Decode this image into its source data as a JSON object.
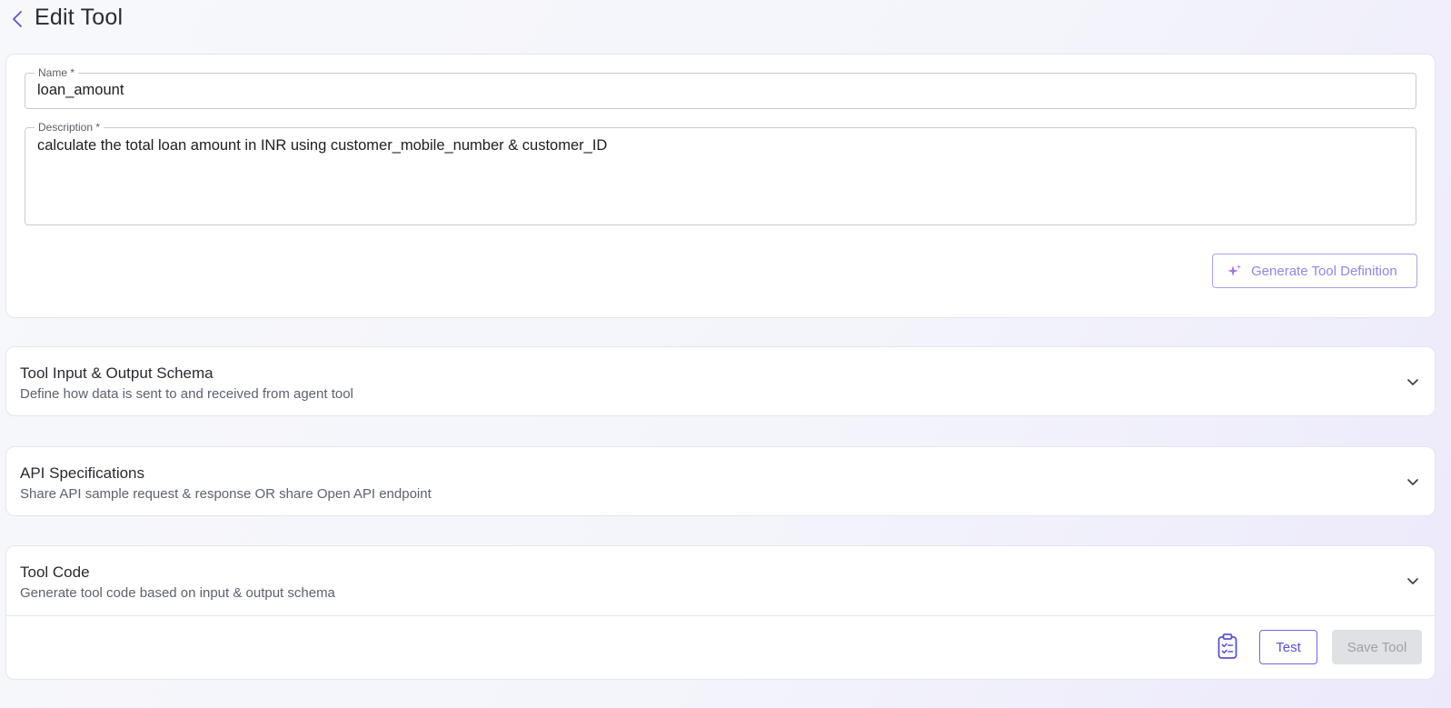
{
  "header": {
    "title": "Edit Tool",
    "back_icon": "chevron-left-icon"
  },
  "form": {
    "name_label": "Name *",
    "name_value": "loan_amount",
    "description_label": "Description *",
    "description_value": "calculate the total loan amount in INR using customer_mobile_number & customer_ID",
    "generate_button_label": "Generate Tool Definition",
    "generate_icon": "sparkle-icon"
  },
  "sections": [
    {
      "title": "Tool Input & Output Schema",
      "subtitle": "Define how data is sent to and received from agent tool"
    },
    {
      "title": "API Specifications",
      "subtitle": "Share API sample request & response OR share Open API endpoint"
    },
    {
      "title": "Tool Code",
      "subtitle": "Generate tool code based on input & output schema"
    }
  ],
  "footer": {
    "clipboard_icon": "clipboard-check-icon",
    "test_label": "Test",
    "save_label": "Save Tool"
  },
  "colors": {
    "accent": "#5a52cf",
    "accent_light": "#8f88e3",
    "disabled_bg": "#e0e1e5"
  }
}
